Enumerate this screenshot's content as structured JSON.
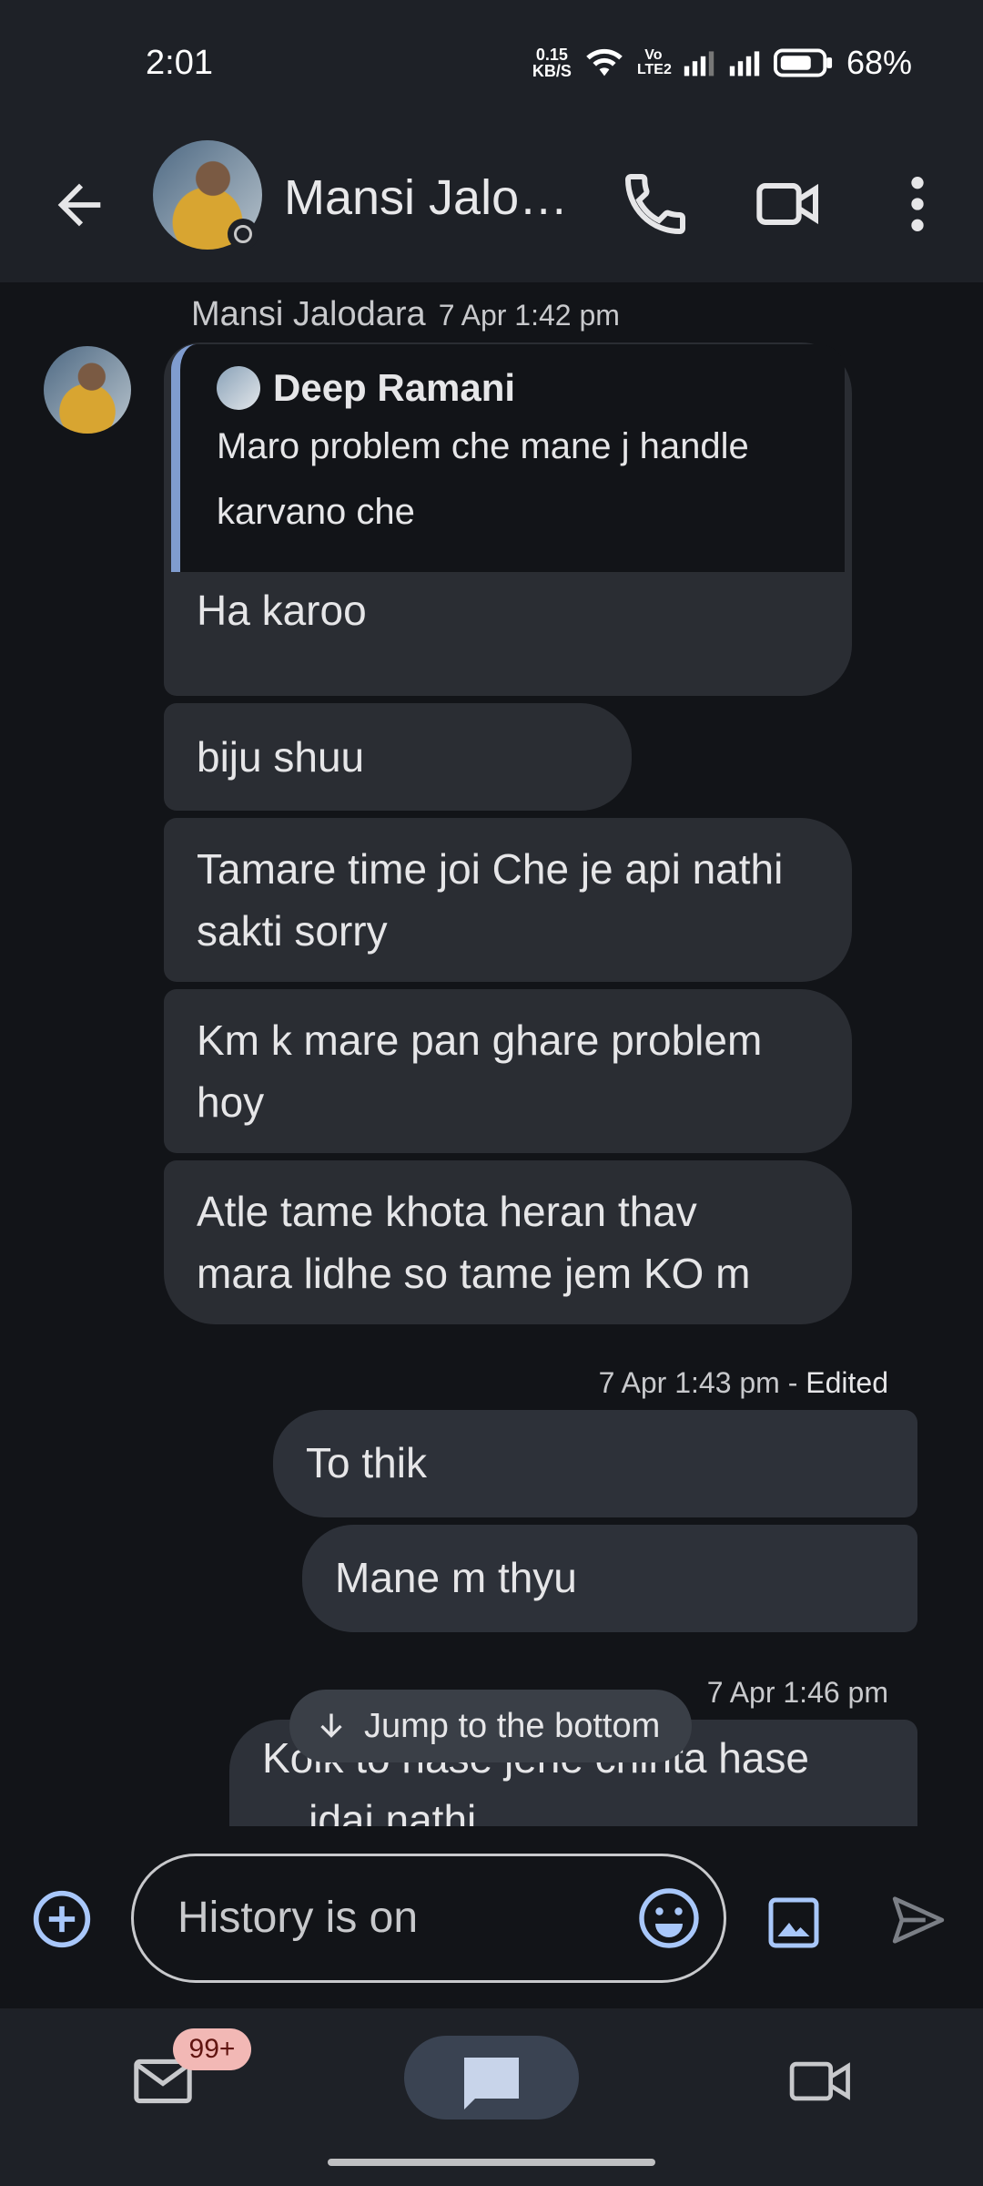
{
  "status_bar": {
    "time": "2:01",
    "speed_value": "0.15",
    "speed_unit": "KB/S",
    "lte_label": "Vo LTE2",
    "battery": "68%"
  },
  "header": {
    "contact_name": "Mansi Jalo…"
  },
  "conversation": {
    "sender_name": "Mansi Jalodara",
    "sender_time": "7 Apr 1:42 pm",
    "quoted": {
      "author": "Deep Ramani",
      "text_line1": "Maro problem che mane j handle",
      "text_line2": "karvano che"
    },
    "incoming": [
      {
        "line1": "Ha karoo",
        "line2": ""
      },
      {
        "line1": "biju shuu",
        "line2": ""
      },
      {
        "line1": "Tamare time joi Che je api nathi",
        "line2": "sakti sorry"
      },
      {
        "line1": "Km k mare pan ghare problem",
        "line2": "hoy"
      },
      {
        "line1": "Atle tame khota heran thav",
        "line2": "mara lidhe so tame jem KO m"
      }
    ],
    "out_meta_1_time": "7 Apr 1:43 pm",
    "out_meta_1_sep": " - ",
    "out_meta_1_edited": "Edited",
    "outgoing": [
      {
        "text": "To thik"
      },
      {
        "text": "Mane m thyu"
      }
    ],
    "out_meta_2_time": "7 Apr 1:46 pm",
    "partial_line1": "Koik to hase jene chinta hase",
    "partial_line2": "... idai nathi"
  },
  "jump_button": {
    "label": "Jump to the bottom"
  },
  "compose": {
    "placeholder": "History is on"
  },
  "bottom_nav": {
    "mail_badge": "99+"
  },
  "colors": {
    "accent": "#a8c7fa",
    "badge_bg": "#f2b8b5",
    "surface": "#1e2127",
    "bubble": "#2a2d33"
  }
}
